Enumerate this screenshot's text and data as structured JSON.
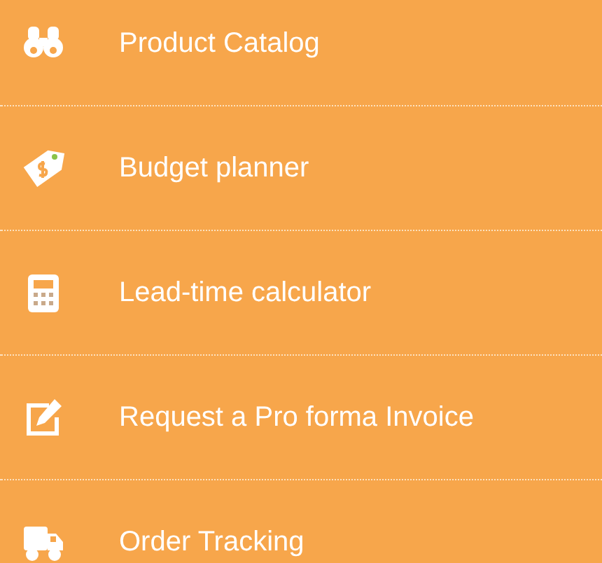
{
  "menu": {
    "items": [
      {
        "label": "Product Catalog"
      },
      {
        "label": "Budget planner"
      },
      {
        "label": "Lead-time calculator"
      },
      {
        "label": "Request a Pro forma Invoice"
      },
      {
        "label": "Order Tracking"
      }
    ]
  }
}
